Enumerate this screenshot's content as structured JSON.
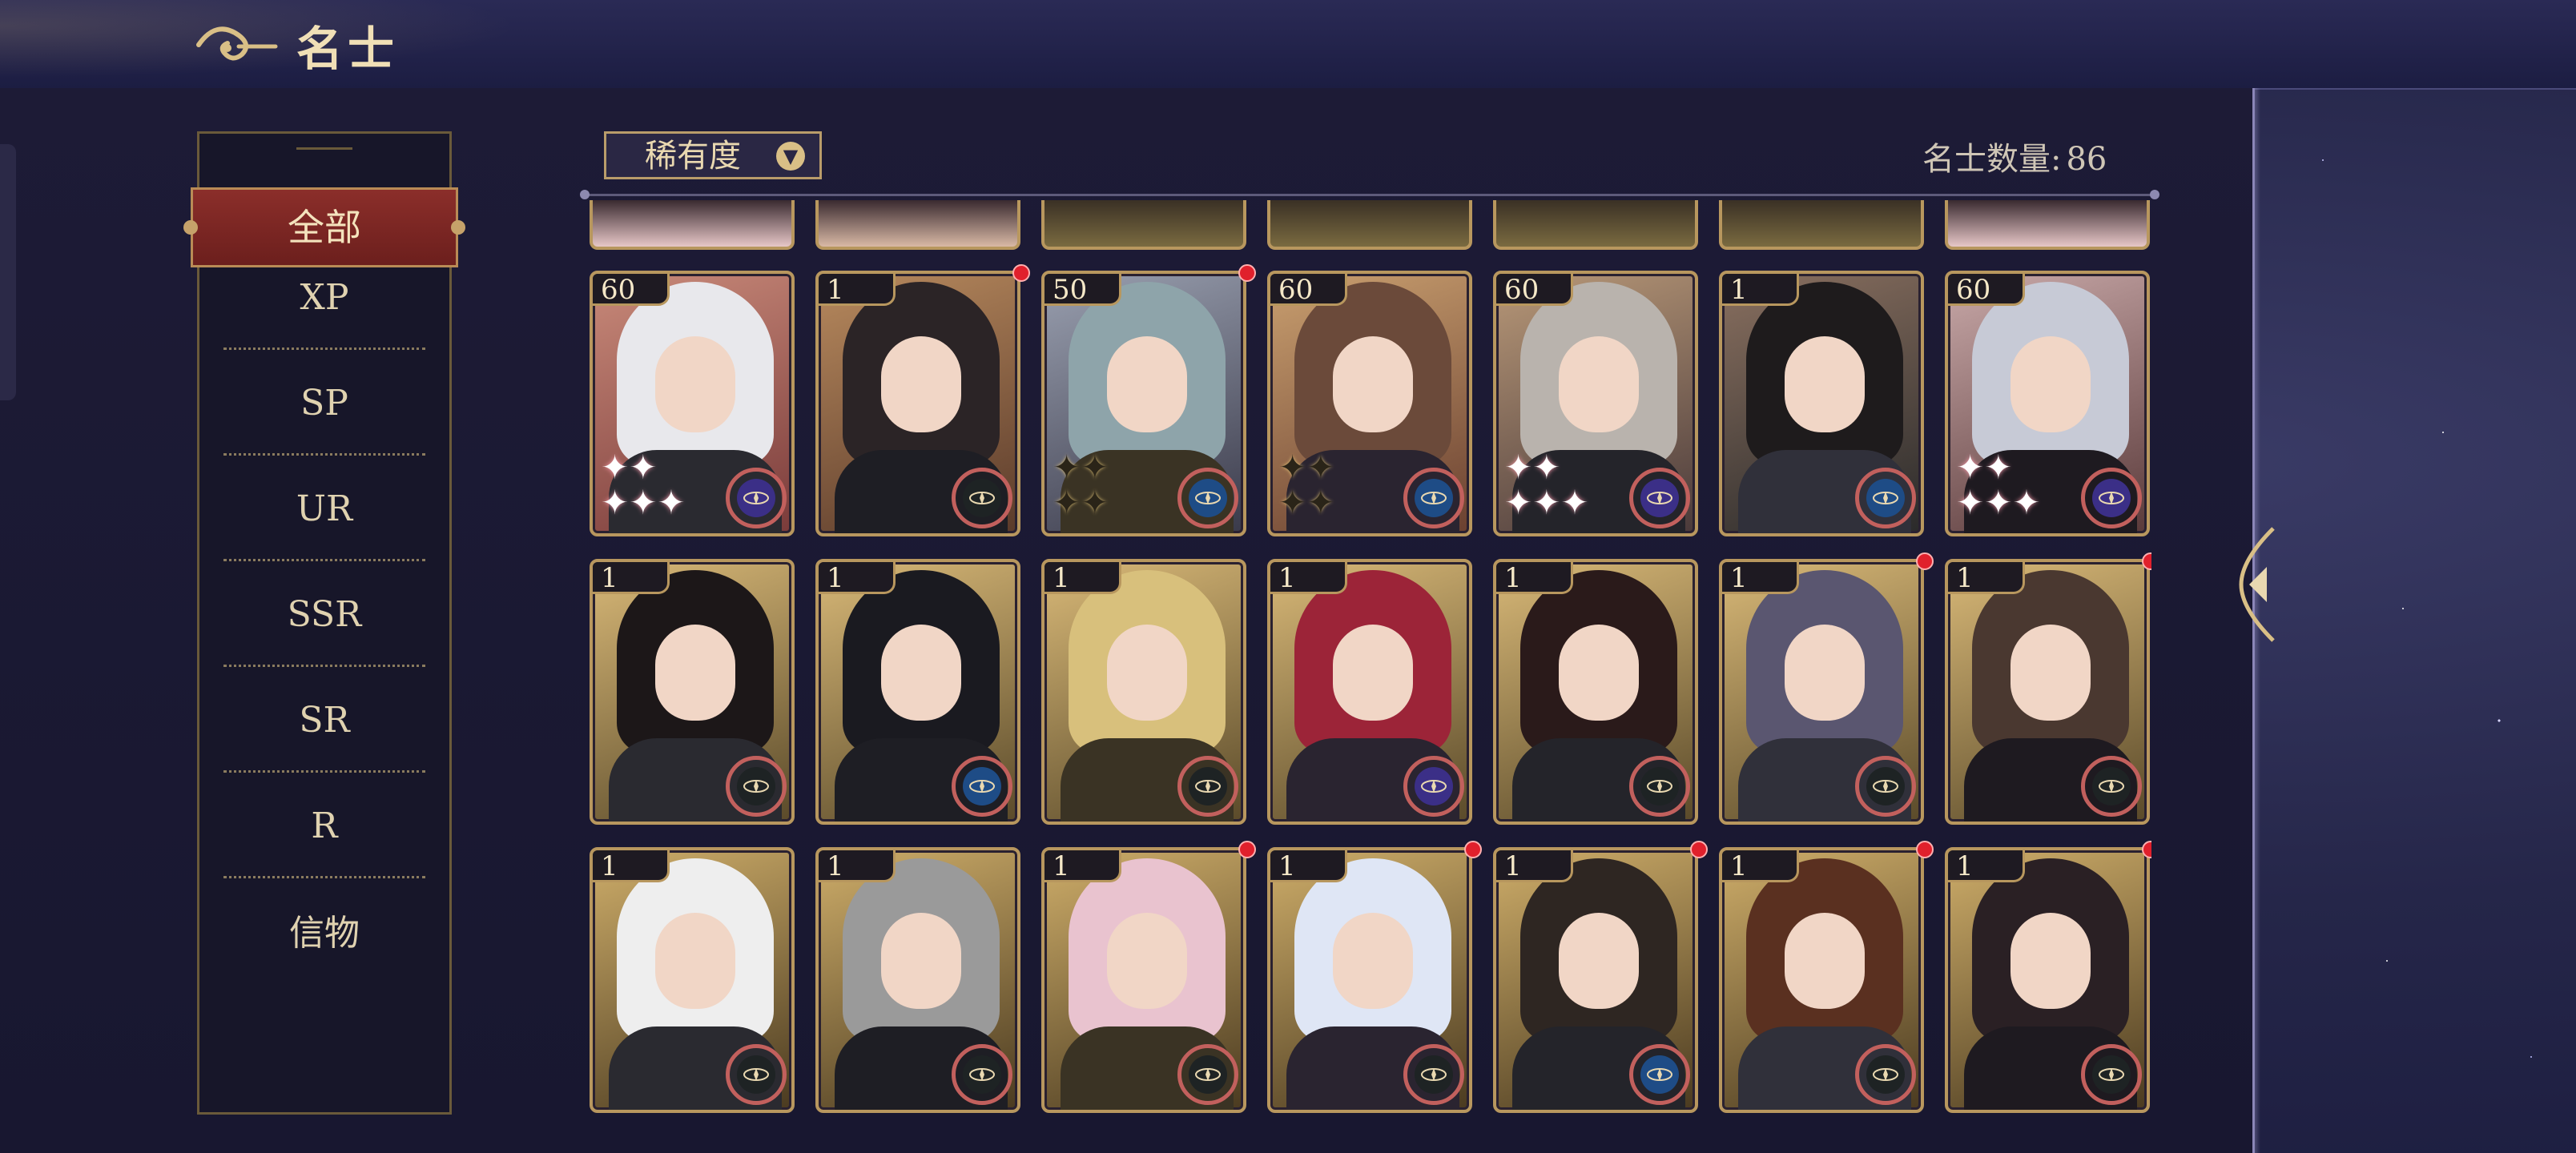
{
  "header": {
    "title": "名士"
  },
  "categories": {
    "active": "全部",
    "items": [
      "XP",
      "SP",
      "UR",
      "SSR",
      "SR",
      "R",
      "信物"
    ]
  },
  "toolbar": {
    "rarity_label": "稀有度",
    "count_label": "名士数量:",
    "count_value": "86"
  },
  "colors": {
    "accent_gold": "#b8975e",
    "active_tab_red": "#8b2e2a",
    "notification_red": "#e0202c",
    "element_purple": "#3b2f87",
    "element_blue": "#1e4c86",
    "element_dark": "#1e2324"
  },
  "rows": [
    [
      {
        "level": "60",
        "element": "purple",
        "sparkle": "pink",
        "badge": false
      },
      {
        "level": "1",
        "element": "dark",
        "sparkle": "none",
        "badge": true
      },
      {
        "level": "50",
        "element": "blue",
        "sparkle": "gold",
        "badge": true
      },
      {
        "level": "60",
        "element": "blue",
        "sparkle": "gold",
        "badge": false
      },
      {
        "level": "60",
        "element": "purple",
        "sparkle": "pink",
        "badge": false
      },
      {
        "level": "1",
        "element": "blue",
        "sparkle": "none",
        "badge": false
      },
      {
        "level": "60",
        "element": "purple",
        "sparkle": "pink",
        "badge": false
      }
    ],
    [
      {
        "level": "1",
        "element": "dark",
        "sparkle": "none",
        "badge": false
      },
      {
        "level": "1",
        "element": "blue",
        "sparkle": "none",
        "badge": false
      },
      {
        "level": "1",
        "element": "dark",
        "sparkle": "none",
        "badge": false
      },
      {
        "level": "1",
        "element": "purple",
        "sparkle": "none",
        "badge": false
      },
      {
        "level": "1",
        "element": "dark",
        "sparkle": "none",
        "badge": false
      },
      {
        "level": "1",
        "element": "dark",
        "sparkle": "none",
        "badge": true
      },
      {
        "level": "1",
        "element": "dark",
        "sparkle": "none",
        "badge": true
      }
    ],
    [
      {
        "level": "1",
        "element": "dark",
        "sparkle": "none",
        "badge": false
      },
      {
        "level": "1",
        "element": "dark",
        "sparkle": "none",
        "badge": false
      },
      {
        "level": "1",
        "element": "dark",
        "sparkle": "none",
        "badge": true
      },
      {
        "level": "1",
        "element": "dark",
        "sparkle": "none",
        "badge": true
      },
      {
        "level": "1",
        "element": "blue",
        "sparkle": "none",
        "badge": true
      },
      {
        "level": "1",
        "element": "dark",
        "sparkle": "none",
        "badge": true
      },
      {
        "level": "1",
        "element": "dark",
        "sparkle": "none",
        "badge": true
      }
    ]
  ]
}
